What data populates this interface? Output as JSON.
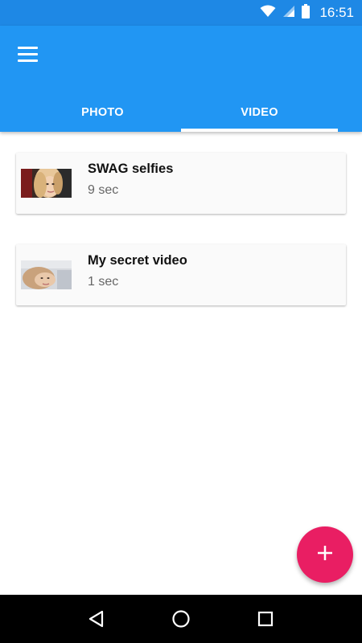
{
  "status_bar": {
    "time": "16:51",
    "icons": [
      "wifi-icon",
      "signal-icon",
      "battery-icon"
    ]
  },
  "app_bar": {
    "menu_icon": "menu-icon",
    "tabs": [
      {
        "label": "PHOTO",
        "selected": false
      },
      {
        "label": "VIDEO",
        "selected": true
      }
    ]
  },
  "videos": [
    {
      "title": "SWAG selfies",
      "duration": "9 sec"
    },
    {
      "title": "My secret video",
      "duration": "1 sec"
    }
  ],
  "fab": {
    "icon": "plus-icon"
  },
  "nav_bar": {
    "icons": [
      "back-icon",
      "home-icon",
      "recents-icon"
    ]
  },
  "colors": {
    "primary": "#2196f3",
    "primary_dark": "#1e88e5",
    "accent": "#e91e63",
    "card_bg": "#fafafa"
  }
}
